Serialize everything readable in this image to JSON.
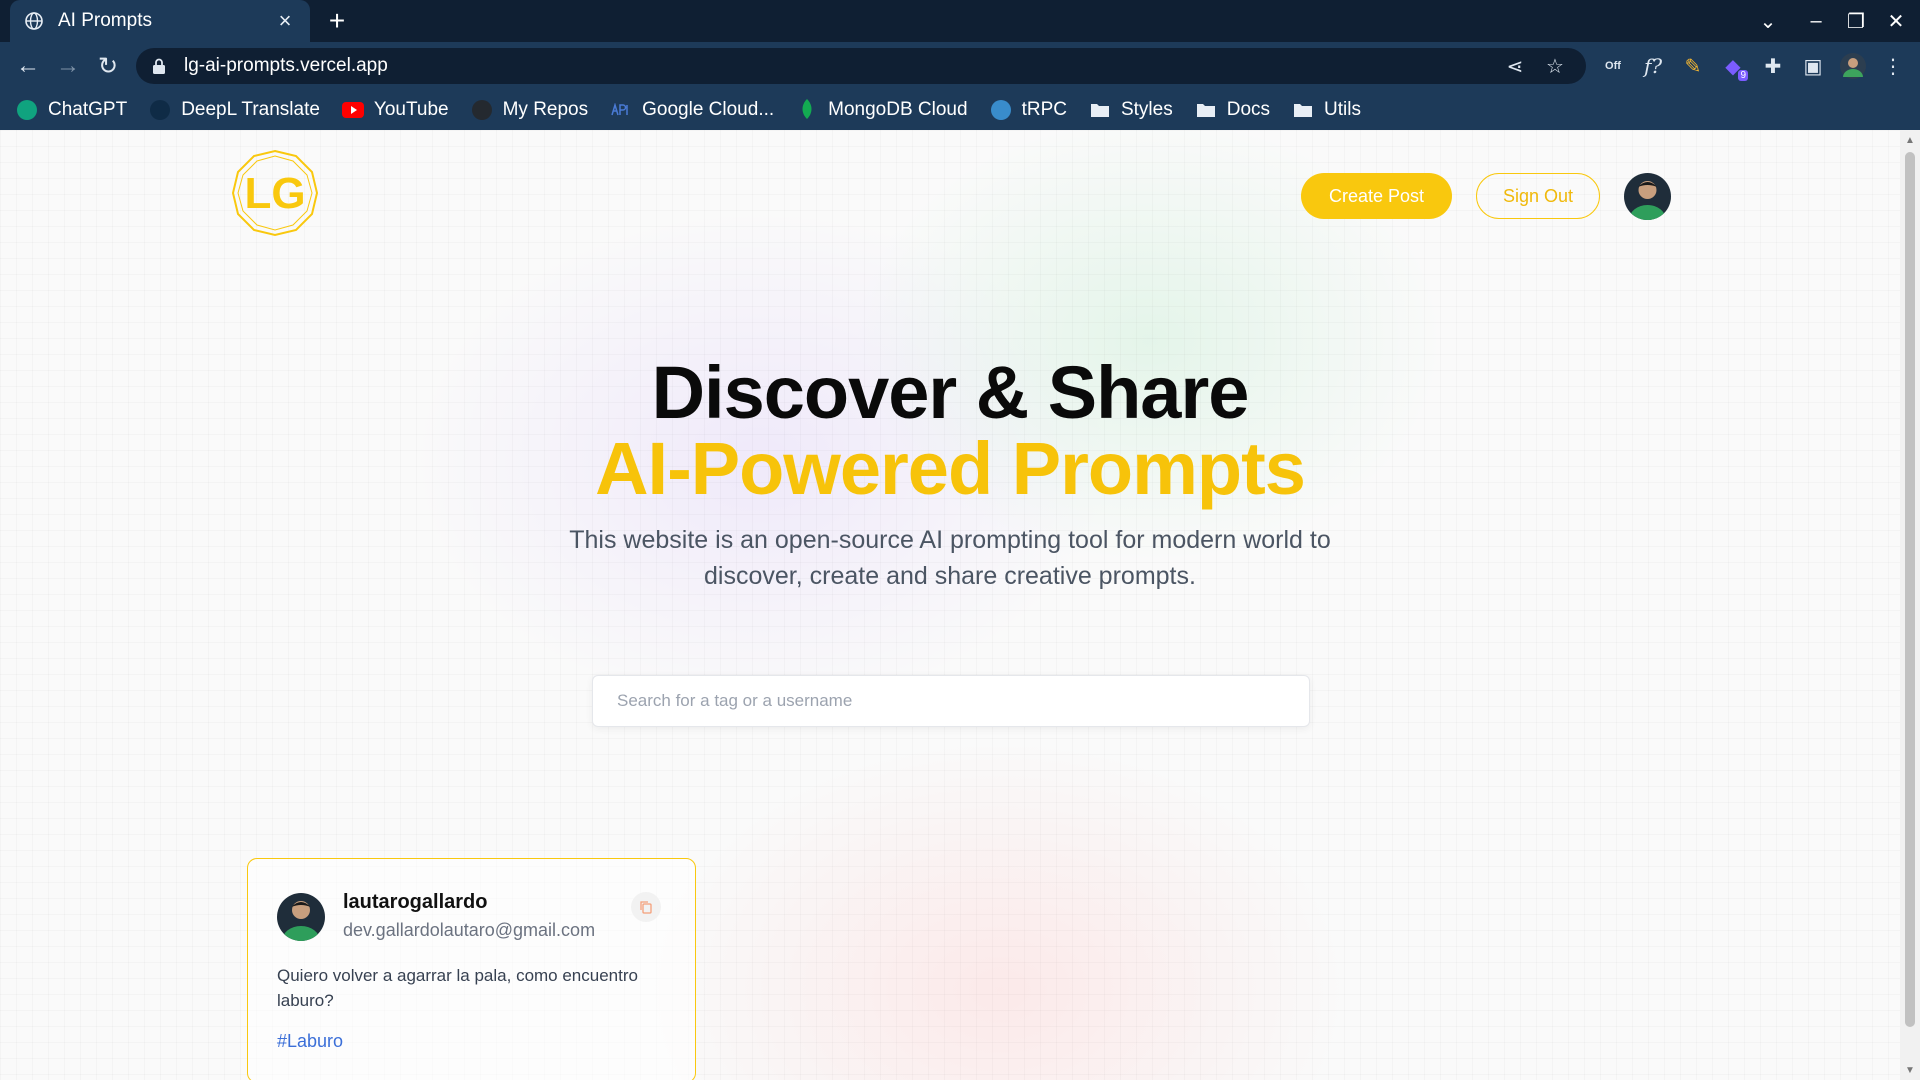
{
  "browser": {
    "tab_title": "AI Prompts",
    "url": "lg-ai-prompts.vercel.app",
    "bookmarks": [
      {
        "label": "ChatGPT",
        "icon": "chatgpt-icon",
        "color": "#10a37f"
      },
      {
        "label": "DeepL Translate",
        "icon": "deepl-icon",
        "color": "#0f2b46"
      },
      {
        "label": "YouTube",
        "icon": "youtube-icon",
        "color": "#ff0000"
      },
      {
        "label": "My Repos",
        "icon": "github-icon",
        "color": "#24292f"
      },
      {
        "label": "Google Cloud...",
        "icon": "api-icon",
        "color": "#4a7bd6"
      },
      {
        "label": "MongoDB Cloud",
        "icon": "mongodb-icon",
        "color": "#13aa52"
      },
      {
        "label": "tRPC",
        "icon": "trpc-icon",
        "color": "#398ccb"
      },
      {
        "label": "Styles",
        "icon": "folder-icon",
        "color": "#e8eef5"
      },
      {
        "label": "Docs",
        "icon": "folder-icon",
        "color": "#e8eef5"
      },
      {
        "label": "Utils",
        "icon": "folder-icon",
        "color": "#e8eef5"
      }
    ],
    "extension_badge": "9",
    "ext_off_label": "Off",
    "formula_label": "f?"
  },
  "header": {
    "logo_text": "LG",
    "create_post_label": "Create Post",
    "sign_out_label": "Sign Out"
  },
  "hero": {
    "title_line1": "Discover & Share",
    "title_line2": "AI-Powered Prompts",
    "description": "This website is an open-source AI prompting tool for modern world to discover, create and share creative prompts."
  },
  "search": {
    "placeholder": "Search for a tag or a username",
    "value": ""
  },
  "posts": [
    {
      "username": "lautarogallardo",
      "email": "dev.gallardolautaro@gmail.com",
      "prompt": "Quiero volver a agarrar la pala, como encuentro laburo?",
      "tag": "#Laburo"
    }
  ],
  "colors": {
    "accent": "#f9c80e",
    "tag_link": "#3b6fd8",
    "chrome_dark": "#0f1f33",
    "chrome": "#1d3a59"
  }
}
